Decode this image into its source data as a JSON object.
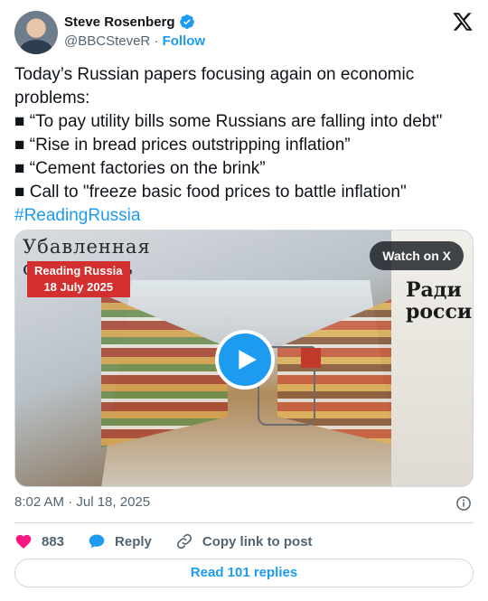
{
  "author": {
    "name": "Steve Rosenberg",
    "handle": "@BBCSteveR",
    "separator": "·",
    "follow_label": "Follow",
    "verified_icon": "verified-badge-icon",
    "brand_icon": "x-logo-icon"
  },
  "tweet": {
    "intro_line1": "Today’s Russian papers focusing again on economic",
    "intro_line2": "problems:",
    "bullets": [
      "■  “To pay utility bills some Russians are falling into debt\"",
      "■  “Rise in bread prices outstripping inflation”",
      "■ “Cement factories on the brink”",
      "■  Call to \"freeze basic food prices to battle inflation\""
    ],
    "hashtag": "#ReadingRussia"
  },
  "media": {
    "badge_title": "Reading Russia",
    "badge_date": "18 July 2025",
    "watch_label": "Watch on X",
    "newspaper_headline": "Убавленная стоимость",
    "newspaper_right_title": "Ради росси",
    "play_icon": "play-icon"
  },
  "meta": {
    "timestamp": "8:02 AM · Jul 18, 2025"
  },
  "actions": {
    "like_count": "883",
    "reply_label": "Reply",
    "copy_label": "Copy link to post"
  },
  "footer": {
    "read_replies_label": "Read 101 replies"
  },
  "colors": {
    "accent": "#1d9bf0",
    "like": "#f91880",
    "badge_red": "#d32f2f",
    "text": "#0f1419",
    "muted": "#536471"
  }
}
